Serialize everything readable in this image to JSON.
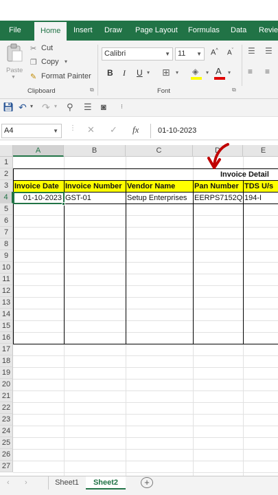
{
  "ribbon_tabs": [
    "File",
    "Home",
    "Insert",
    "Draw",
    "Page Layout",
    "Formulas",
    "Data",
    "Revie"
  ],
  "active_tab": "Home",
  "clipboard": {
    "paste_label": "Paste",
    "cut_label": "Cut",
    "copy_label": "Copy",
    "format_painter_label": "Format Painter",
    "group_label": "Clipboard"
  },
  "font": {
    "name": "Calibri",
    "size": "11",
    "group_label": "Font",
    "bold": "B",
    "italic": "I",
    "underline": "U"
  },
  "formula_bar": {
    "name_box": "A4",
    "content": "01-10-2023"
  },
  "columns": [
    "A",
    "B",
    "C",
    "D",
    "E"
  ],
  "rows": [
    "1",
    "2",
    "3",
    "4",
    "5",
    "6",
    "7",
    "8",
    "9",
    "10",
    "11",
    "12",
    "13",
    "14",
    "15",
    "16",
    "17",
    "18",
    "19",
    "20",
    "21",
    "22",
    "23",
    "24",
    "25",
    "26",
    "27"
  ],
  "sheet": {
    "title": "Invoice Detail",
    "headers": [
      "Invoice Date",
      "Invoice Number",
      "Vendor Name",
      "Pan Number",
      "TDS U/s"
    ],
    "row4": [
      "01-10-2023",
      "GST-01",
      "Setup Enterprises",
      "EERPS7152Q",
      "194-I"
    ]
  },
  "sheet_tabs": [
    "Sheet1",
    "Sheet2"
  ],
  "active_sheet": "Sheet2",
  "colors": {
    "accent": "#217346",
    "header_fill": "#ffff00",
    "annotation_arrow": "#c00000"
  }
}
